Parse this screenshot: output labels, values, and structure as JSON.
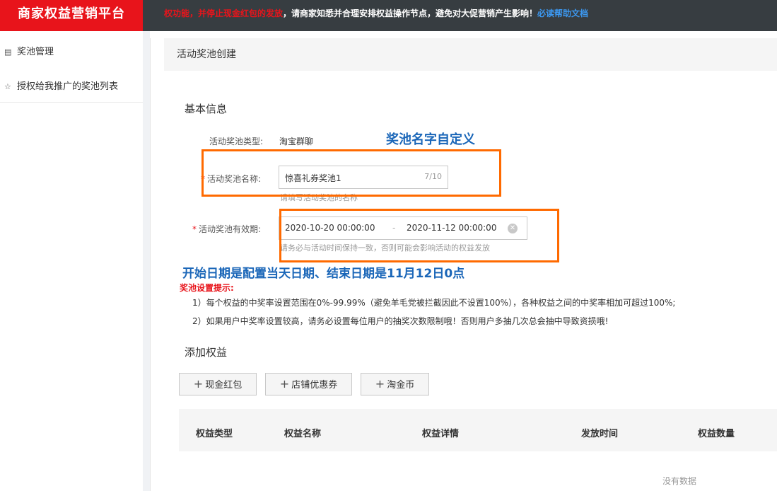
{
  "brand": "商家权益营销平台",
  "notice": {
    "red": "权功能，并停止现金红包的发放",
    "white": "，请商家知悉并合理安排权益操作节点，避免对大促营销产生影响！",
    "link": "必读帮助文档"
  },
  "sidebar": {
    "items": [
      {
        "label": "奖池管理",
        "icon": "calendar-icon"
      },
      {
        "label": "授权给我推广的奖池列表",
        "icon": "pin-icon"
      }
    ]
  },
  "page_title": "活动奖池创建",
  "basic_info": {
    "title": "基本信息",
    "type_label": "活动奖池类型:",
    "type_value": "淘宝群聊",
    "name_label": "活动奖池名称:",
    "name_value": "惊喜礼券奖池1",
    "name_count": "7/10",
    "name_hint": "请填写活动奖池的名称",
    "period_label": "活动奖池有效期:",
    "start": "2020-10-20 00:00:00",
    "sep": "-",
    "end": "2020-11-12 00:00:00",
    "period_hint": "请务必与活动时间保持一致，否则可能会影响活动的权益发放"
  },
  "annotations": {
    "name_note": "奖池名字自定义",
    "date_note": "开始日期是配置当天日期、结束日期是11月12日0点",
    "color": "#ff6a00"
  },
  "tips": {
    "title": "奖池设置提示:",
    "line1": "1）每个权益的中奖率设置范围在0%-99.99%（避免羊毛党被拦截因此不设置100%），各种权益之间的中奖率相加可超过100%;",
    "line2": "2）如果用户中奖率设置较高，请务必设置每位用户的抽奖次数限制哦！否则用户多抽几次总会抽中导致资损哦!"
  },
  "add_rights": {
    "title": "添加权益",
    "buttons": [
      "现金红包",
      "店铺优惠券",
      "淘金币"
    ]
  },
  "table": {
    "headers": [
      "权益类型",
      "权益名称",
      "权益详情",
      "发放时间",
      "权益数量"
    ],
    "empty": "没有数据"
  }
}
